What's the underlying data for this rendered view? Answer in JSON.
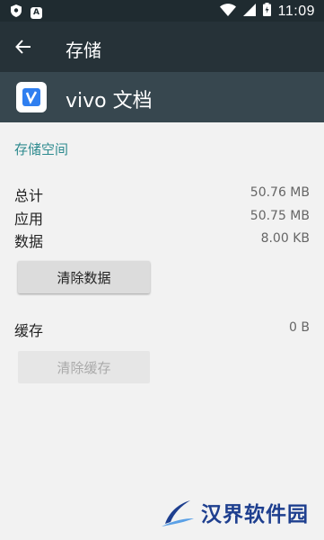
{
  "status_bar": {
    "time": "11:09"
  },
  "app_bar": {
    "title": "存储"
  },
  "app": {
    "name": "vivo 文档"
  },
  "storage": {
    "section_title": "存储空间",
    "rows": [
      {
        "label": "总计",
        "value": "50.76 MB"
      },
      {
        "label": "应用",
        "value": "50.75 MB"
      },
      {
        "label": "数据",
        "value": "8.00 KB"
      }
    ],
    "clear_data_label": "清除数据",
    "cache_label": "缓存",
    "cache_value": "0 B",
    "clear_cache_label": "清除缓存"
  },
  "watermark": {
    "text": "汉界软件园"
  },
  "colors": {
    "status_bar": "#1f2b30",
    "app_bar": "#263238",
    "app_header": "#37474f",
    "accent": "#2e8b8f",
    "watermark": "#1e3f8f"
  }
}
